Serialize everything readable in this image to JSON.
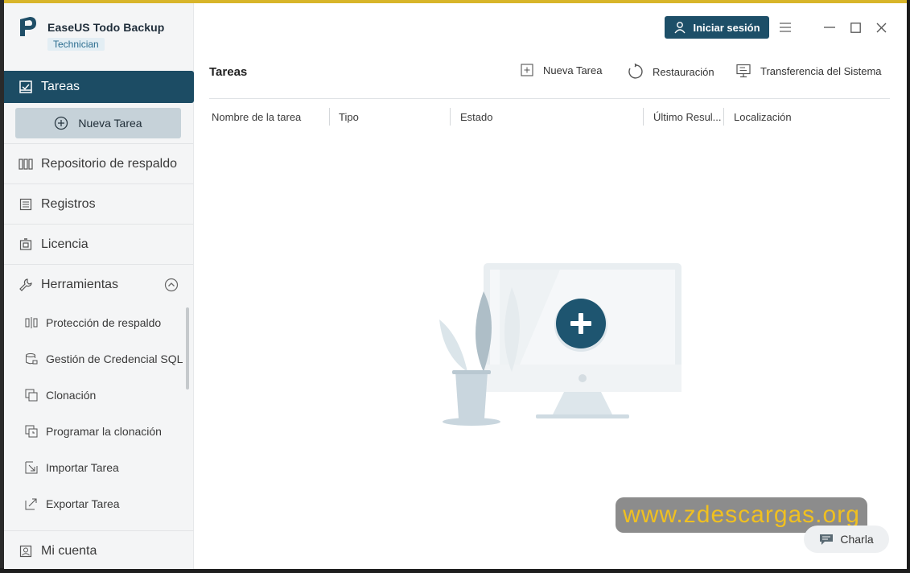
{
  "app": {
    "name": "EaseUS Todo Backup",
    "edition": "Technician"
  },
  "sidebar": {
    "tasks_label": "Tareas",
    "new_task_label": "Nueva Tarea",
    "items": [
      {
        "label": "Repositorio de respaldo"
      },
      {
        "label": "Registros"
      },
      {
        "label": "Licencia"
      }
    ],
    "tools_label": "Herramientas",
    "tools": [
      {
        "label": "Protección de respaldo"
      },
      {
        "label": "Gestión de Credencial SQL"
      },
      {
        "label": "Clonación"
      },
      {
        "label": "Programar la clonación"
      },
      {
        "label": "Importar Tarea"
      },
      {
        "label": "Exportar Tarea"
      }
    ],
    "account_label": "Mi cuenta"
  },
  "header": {
    "login_label": "Iniciar sesión"
  },
  "toolbar": {
    "title": "Tareas",
    "new_task": "Nueva Tarea",
    "restore": "Restauración",
    "system_transfer": "Transferencia del Sistema"
  },
  "table": {
    "columns": [
      "Nombre de la tarea",
      "Tipo",
      "Estado",
      "Último Resul...",
      "Localización"
    ]
  },
  "watermark": "www.zdescargas.org",
  "chat_label": "Charla",
  "colors": {
    "accent": "#1c4c64",
    "sidebar_bg": "#f4f5f6",
    "new_task_bg": "#c6d2d9",
    "watermark_text": "#f0c020"
  }
}
